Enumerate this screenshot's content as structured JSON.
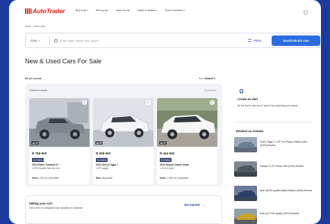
{
  "nav": {
    "logo": "AutoTrader",
    "items": [
      {
        "label": "Buy a car"
      },
      {
        "label": "Sell my car"
      },
      {
        "label": "Value my car"
      },
      {
        "label": "News & reviews"
      },
      {
        "label": "Tools & services"
      }
    ]
  },
  "breadcrumb": "Home > Used Cars",
  "search": {
    "category": "Cars",
    "placeholder": "Enter Make, Model and Variant",
    "filters_label": "Filters",
    "button_label": "Search 85 441 cars"
  },
  "page": {
    "title": "New & Used Cars For Sale",
    "results": "85 441 results",
    "sort_label": "Sort:",
    "sort_value": "Default"
  },
  "featured": {
    "label": "Featured results",
    "sponsored": "Sponsored",
    "cards": [
      {
        "price": "R 769 900",
        "badge": "No Rating",
        "name": "2024 Foton Tunland V7",
        "variant": "2.0TD Double Cab 4x4 4x4",
        "condition": "Used",
        "km": "100 km",
        "trans": "Automatic",
        "photos": "28",
        "color": "#8a8f96"
      },
      {
        "price": "R 539 900",
        "badge": "No Rating",
        "name": "2024 Chery Tiggo 7",
        "variant": "1.5T Legacy",
        "condition": "New",
        "km": "",
        "trans": "Automatic",
        "photos": "24",
        "color": "#e9ecf0"
      },
      {
        "price": "R 444 900",
        "badge": "No Rating",
        "name": "2024 Suzuki Grand Vitara",
        "variant": "1.5 GLX Auto",
        "condition": "Used",
        "km": "1 800 km",
        "trans": "Automatic",
        "photos": "22",
        "color": "#f2f3f5"
      }
    ]
  },
  "selling": {
    "title": "Selling your car?",
    "desc": "Get a free, no-obligation car valuation in seconds!",
    "button": "Get started"
  },
  "sidebar": {
    "alert_title": "Create an alert",
    "alert_desc": "Be the first to see new & Used Cars matching your search",
    "reviews_heading": "Related car reviews",
    "reviews": [
      {
        "title": "Chery Tiggo 7 1.5T Cvh Plug-In Hybrid Ultra (2024) Review",
        "color": "#6b7c93"
      },
      {
        "title": "Geleya T1.5T Gtnow X90 (2024) Review",
        "color": "#4d5661"
      },
      {
        "title": "Audi Q8 RS quattro Black Edition (2024) Review",
        "color": "#2b3d6b"
      },
      {
        "title": "Audi Q3 TFSI quattro (2024) Review",
        "color": "#c9a227"
      }
    ]
  }
}
